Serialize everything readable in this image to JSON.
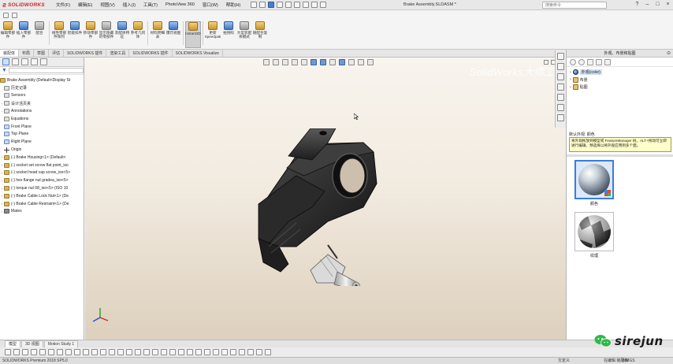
{
  "app": {
    "logo_text": "SOLIDWORKS",
    "menus": [
      "文件(F)",
      "编辑(E)",
      "视图(V)",
      "插入(I)",
      "工具(T)",
      "PhotoView 360",
      "窗口(W)",
      "帮助(H)"
    ],
    "document_title": "Brake Assembly.SLDASM *",
    "search_placeholder": "搜索命令"
  },
  "toolbar": {
    "commands": [
      {
        "label": "编辑零部件",
        "icon": "edit-component-icon"
      },
      {
        "label": "插入零部件",
        "icon": "insert-component-icon"
      },
      {
        "label": "配合",
        "icon": "mate-icon"
      },
      {
        "label": "线性零部件阵列",
        "icon": "linear-pattern-icon"
      },
      {
        "label": "智能扣件",
        "icon": "smart-fasteners-icon"
      },
      {
        "label": "移动零部件",
        "icon": "move-component-icon"
      },
      {
        "label": "显示隐藏的零部件",
        "icon": "show-hidden-icon"
      },
      {
        "label": "装配体特征",
        "icon": "assembly-feature-icon"
      },
      {
        "label": "参考几何体",
        "icon": "reference-geometry-icon"
      },
      {
        "label": "材料明细表",
        "icon": "bom-icon"
      },
      {
        "label": "爆炸视图",
        "icon": "exploded-view-icon"
      },
      {
        "label": "Instant3D",
        "icon": "instant3d-icon",
        "active": true
      },
      {
        "label": "更新Speedpak",
        "icon": "speedpak-icon"
      },
      {
        "label": "拍快照",
        "icon": "snapshot-icon"
      },
      {
        "label": "大型装配体模式",
        "icon": "large-assembly-icon"
      },
      {
        "label": "随配合复制",
        "icon": "copy-with-mates-icon"
      }
    ]
  },
  "command_tabs": [
    "装配体",
    "布局",
    "草图",
    "评估",
    "SOLIDWORKS 插件",
    "渲染工具",
    "SOLIDWORKS 插件",
    "SOLIDWORKS Visualize"
  ],
  "feature_tree": {
    "root": "Brake Assembly  (Default<Display St",
    "items": [
      {
        "label": "历史记录",
        "icon": "history-icon",
        "kind": "sensor"
      },
      {
        "label": "Sensors",
        "icon": "sensor-icon",
        "kind": "sensor"
      },
      {
        "label": "设计活页夹",
        "icon": "design-binder-icon",
        "kind": "sensor",
        "expand": true
      },
      {
        "label": "Annotations",
        "icon": "annotations-icon",
        "kind": "sensor",
        "expand": true
      },
      {
        "label": "Equations",
        "icon": "equations-icon",
        "kind": "sensor"
      },
      {
        "label": "Front Plane",
        "icon": "plane-icon",
        "kind": "plane"
      },
      {
        "label": "Top Plane",
        "icon": "plane-icon",
        "kind": "plane"
      },
      {
        "label": "Right Plane",
        "icon": "plane-icon",
        "kind": "plane"
      },
      {
        "label": "Origin",
        "icon": "origin-icon",
        "kind": "origin"
      },
      {
        "label": "(-) Brake Housing<1> (Default<",
        "icon": "part-icon",
        "kind": "part",
        "expand": true
      },
      {
        "label": "(-) socket set screw flat point_iso",
        "icon": "part-icon",
        "kind": "part",
        "expand": true
      },
      {
        "label": "(-) socket head cap screw_iso<5>",
        "icon": "part-icon",
        "kind": "part",
        "expand": true
      },
      {
        "label": "(-) hex flange nut gradea_iso<5>",
        "icon": "part-icon",
        "kind": "part",
        "expand": true
      },
      {
        "label": "(-) torque nut 08_iso<5> (ISO 10",
        "icon": "part-icon",
        "kind": "part",
        "expand": true
      },
      {
        "label": "(-) Brake Cable Lock Nut<1> (De",
        "icon": "part-icon",
        "kind": "part",
        "expand": true
      },
      {
        "label": "(-) Brake Cable Restraint<1> (De",
        "icon": "part-icon",
        "kind": "part",
        "expand": true
      },
      {
        "label": "Mates",
        "icon": "mates-icon",
        "kind": "mates",
        "expand": true
      }
    ]
  },
  "viewport": {
    "watermark": "SolidWorks大师工"
  },
  "taskpane": {
    "title": "外观、布景和贴图",
    "tree": [
      {
        "label": "外观(color)",
        "selected": true,
        "icon": "appearance-icon"
      },
      {
        "label": "布景",
        "selected": false,
        "icon": "scene-icon"
      },
      {
        "label": "贴图",
        "selected": false,
        "icon": "decal-icon"
      }
    ],
    "tip_label": "默认外观: 颜色",
    "tip_text": "将外观拖放到模型或 FeatureManager 树。ALT+拖动可立即进行编辑。预选择以将外观应用到多个面。",
    "materials": [
      {
        "label": "颜色",
        "icon": "color-sphere-icon",
        "selected": true
      },
      {
        "label": "纹理",
        "icon": "checker-sphere-icon",
        "selected": false
      }
    ]
  },
  "bottom_tabs": [
    "模型",
    "3D 视图",
    "Motion Study 1"
  ],
  "status": {
    "left": "SOLIDWORKS Premium 2018 SP5.0",
    "mid": "欠定义",
    "right": "在编辑 装配体",
    "units": "MMGS"
  },
  "brand": {
    "text": "sirejun"
  }
}
